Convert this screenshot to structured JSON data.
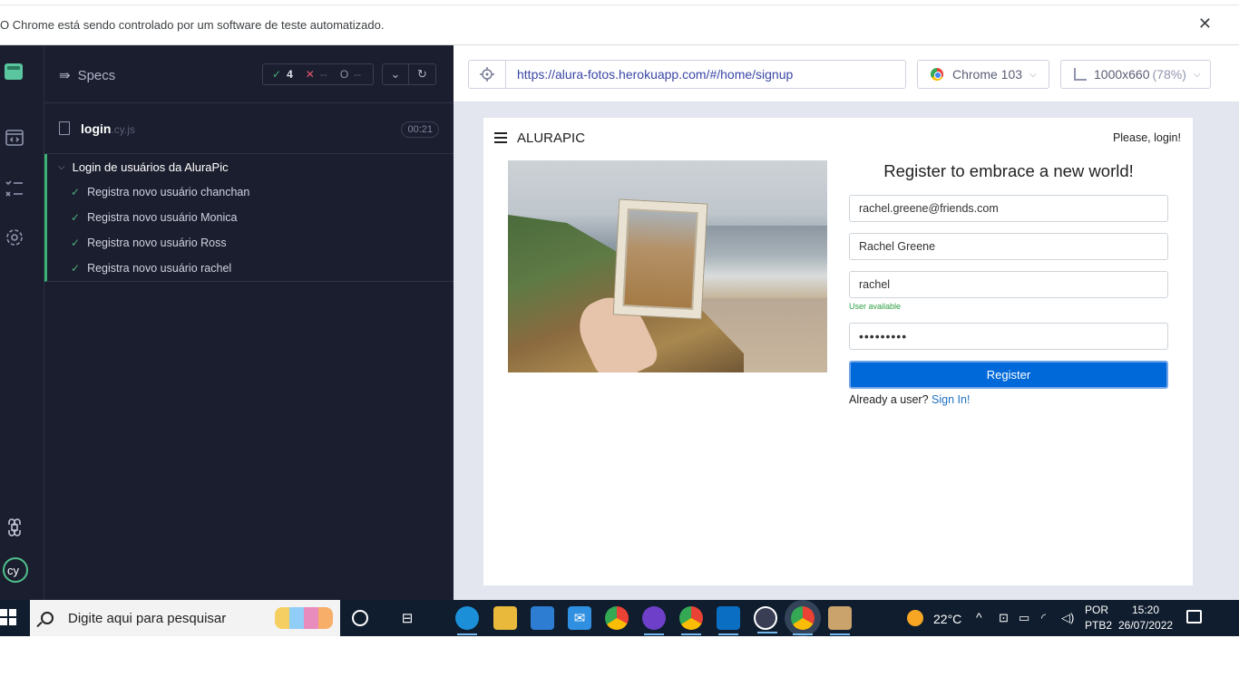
{
  "infobar": {
    "text": "O Chrome está sendo controlado por um software de teste automatizado.",
    "close": "✕"
  },
  "specs": {
    "title": "Specs",
    "stats": {
      "passed": "4",
      "failed": "--",
      "pending": "--"
    },
    "file": {
      "name": "login",
      "ext": ".cy.js",
      "duration": "00:21"
    },
    "suite": {
      "title": "Login de usuários da AluraPic",
      "tests": [
        "Registra novo usuário chanchan",
        "Registra novo usuário Monica",
        "Registra novo usuário Ross",
        "Registra novo usuário rachel"
      ]
    }
  },
  "browser": {
    "url": "https://alura-fotos.herokuapp.com/#/home/signup",
    "browser_name": "Chrome 103",
    "viewport": "1000x660",
    "viewport_scale": "(78%)"
  },
  "app": {
    "brand": "ALURAPIC",
    "nav_login": "Please, login!",
    "form": {
      "title": "Register to embrace a new world!",
      "email": "rachel.greene@friends.com",
      "full_name": "Rachel Greene",
      "username": "rachel",
      "username_hint": "User available",
      "password": "•••••••••",
      "register_label": "Register",
      "already_text": "Already a user?",
      "signin_text": "Sign In!"
    }
  },
  "taskbar": {
    "search_placeholder": "Digite aqui para pesquisar",
    "weather": "22°C",
    "lang_1": "POR",
    "lang_2": "PTB2",
    "time": "15:20",
    "date": "26/07/2022"
  }
}
